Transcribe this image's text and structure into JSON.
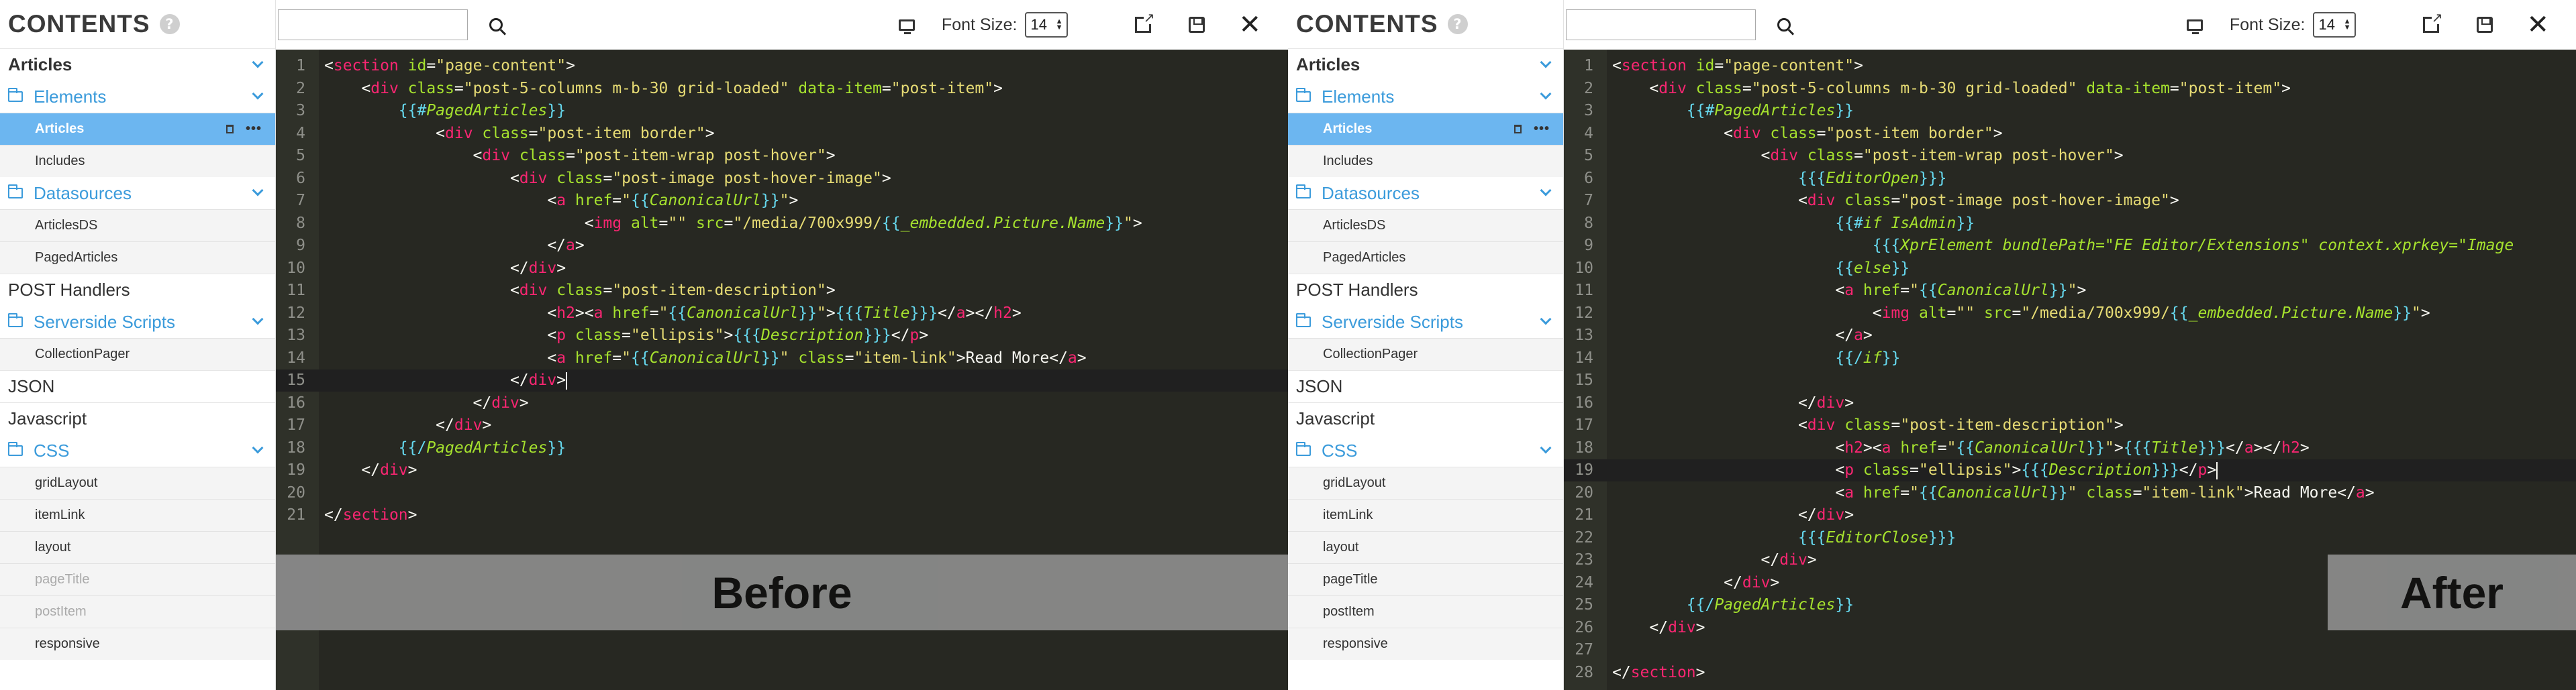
{
  "left": {
    "sidebar": {
      "title": "CONTENTS",
      "help_icon": "?",
      "section_articles": "Articles",
      "folders": [
        {
          "label": "Elements",
          "items": [
            {
              "label": "Articles",
              "selected": true
            },
            {
              "label": "Includes"
            }
          ]
        },
        {
          "label": "Datasources",
          "items": [
            {
              "label": "ArticlesDS"
            },
            {
              "label": "PagedArticles"
            }
          ]
        }
      ],
      "section_post": "POST Handlers",
      "folder_serverside": {
        "label": "Serverside Scripts",
        "items": [
          {
            "label": "CollectionPager"
          }
        ]
      },
      "section_json": "JSON",
      "section_js": "Javascript",
      "folder_css": {
        "label": "CSS",
        "items": [
          {
            "label": "gridLayout"
          },
          {
            "label": "itemLink"
          },
          {
            "label": "layout"
          },
          {
            "label": "pageTitle",
            "dim": true
          },
          {
            "label": "postItem",
            "dim": true
          },
          {
            "label": "responsive"
          }
        ]
      }
    },
    "toolbar": {
      "search_placeholder": "",
      "font_size_label": "Font Size:",
      "font_size_value": "14"
    },
    "code_lines": [
      "<section id=\"page-content\">",
      "    <div class=\"post-5-columns m-b-30 grid-loaded\" data-item=\"post-item\">",
      "        {{#PagedArticles}}",
      "            <div class=\"post-item border\">",
      "                <div class=\"post-item-wrap post-hover\">",
      "                    <div class=\"post-image post-hover-image\">",
      "                        <a href=\"{{CanonicalUrl}}\">",
      "                            <img alt=\"\" src=\"/media/700x999/{{_embedded.Picture.Name}}\">",
      "                        </a>",
      "                    </div>",
      "                    <div class=\"post-item-description\">",
      "                        <h2><a href=\"{{CanonicalUrl}}\">{{{Title}}}</a></h2>",
      "                        <p class=\"ellipsis\">{{{Description}}}</p>",
      "                        <a href=\"{{CanonicalUrl}}\" class=\"item-link\">Read More</a>",
      "                    </div>",
      "                </div>",
      "            </div>",
      "        {{/PagedArticles}}",
      "    </div>",
      "",
      "</section>"
    ],
    "active_line": 15,
    "overlay_label": "Before"
  },
  "right": {
    "sidebar": {
      "title": "CONTENTS",
      "help_icon": "?",
      "section_articles": "Articles",
      "folders": [
        {
          "label": "Elements",
          "items": [
            {
              "label": "Articles",
              "selected": true
            },
            {
              "label": "Includes"
            }
          ]
        },
        {
          "label": "Datasources",
          "items": [
            {
              "label": "ArticlesDS"
            },
            {
              "label": "PagedArticles"
            }
          ]
        }
      ],
      "section_post": "POST Handlers",
      "folder_serverside": {
        "label": "Serverside Scripts",
        "items": [
          {
            "label": "CollectionPager"
          }
        ]
      },
      "section_json": "JSON",
      "section_js": "Javascript",
      "folder_css": {
        "label": "CSS",
        "items": [
          {
            "label": "gridLayout"
          },
          {
            "label": "itemLink"
          },
          {
            "label": "layout"
          },
          {
            "label": "pageTitle"
          },
          {
            "label": "postItem"
          },
          {
            "label": "responsive"
          }
        ]
      }
    },
    "toolbar": {
      "search_placeholder": "",
      "font_size_label": "Font Size:",
      "font_size_value": "14"
    },
    "code_lines": [
      "<section id=\"page-content\">",
      "    <div class=\"post-5-columns m-b-30 grid-loaded\" data-item=\"post-item\">",
      "        {{#PagedArticles}}",
      "            <div class=\"post-item border\">",
      "                <div class=\"post-item-wrap post-hover\">",
      "                    {{{EditorOpen}}}",
      "                    <div class=\"post-image post-hover-image\">",
      "                        {{#if IsAdmin}}",
      "                            {{{XprElement bundlePath=\"FE Editor/Extensions\" context.xprkey=\"Image",
      "                        {{else}}",
      "                        <a href=\"{{CanonicalUrl}}\">",
      "                            <img alt=\"\" src=\"/media/700x999/{{_embedded.Picture.Name}}\">",
      "                        </a>",
      "                        {{/if}}",
      "",
      "                    </div>",
      "                    <div class=\"post-item-description\">",
      "                        <h2><a href=\"{{CanonicalUrl}}\">{{{Title}}}</a></h2>",
      "                        <p class=\"ellipsis\">{{{Description}}}</p>",
      "                        <a href=\"{{CanonicalUrl}}\" class=\"item-link\">Read More</a>",
      "                    </div>",
      "                    {{{EditorClose}}}",
      "                </div>",
      "            </div>",
      "        {{/PagedArticles}}",
      "    </div>",
      "",
      "</section>"
    ],
    "active_line": 19,
    "overlay_label": "After"
  },
  "colors": {
    "accent": "#3b9bdb",
    "selected_bg": "#6cb6f0",
    "editor_bg": "#272822",
    "tag": "#f92672",
    "attr": "#a6e22e",
    "string": "#e6db74"
  },
  "icons": [
    "help-icon",
    "folder-icon",
    "chevron-down-icon",
    "trash-icon",
    "more-icon",
    "search-icon",
    "monitor-icon",
    "external-link-icon",
    "save-icon",
    "close-icon"
  ]
}
